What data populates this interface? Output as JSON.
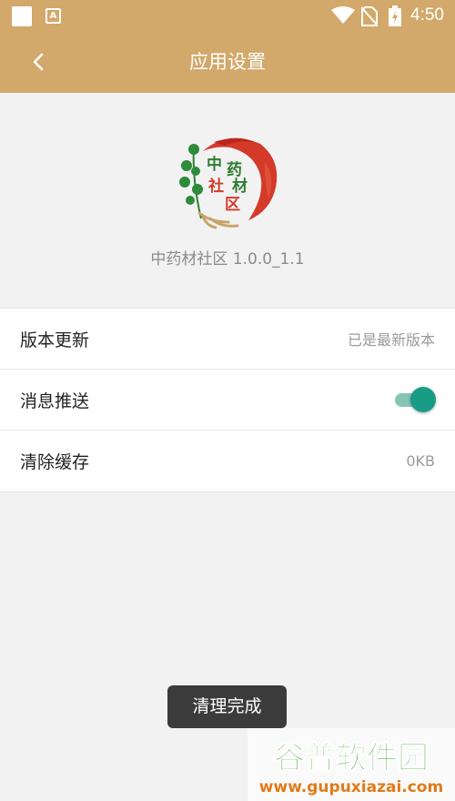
{
  "status_bar": {
    "time": "4:50",
    "icons": [
      "notification-square-icon",
      "a-keyboard-icon",
      "wifi-icon",
      "no-sim-icon",
      "battery-charging-icon"
    ]
  },
  "app_bar": {
    "title": "应用设置",
    "back_icon": "chevron-left-icon"
  },
  "app_info": {
    "logo_text": [
      "中",
      "药",
      "社",
      "材",
      "区"
    ],
    "version_label": "中药材社区 1.0.0_1.1"
  },
  "settings": {
    "items": [
      {
        "label": "版本更新",
        "value": "已是最新版本",
        "kind": "text"
      },
      {
        "label": "消息推送",
        "value": "",
        "kind": "toggle",
        "enabled": true
      },
      {
        "label": "清除缓存",
        "value": "0KB",
        "kind": "text"
      }
    ]
  },
  "toast": {
    "message": "清理完成"
  },
  "watermark": {
    "title": "谷普软件园",
    "url": "www.gupuxiazai.com"
  },
  "colors": {
    "app_bar": "#d3a86b",
    "toggle_on": "#199c85",
    "background": "#f2f2f2"
  }
}
